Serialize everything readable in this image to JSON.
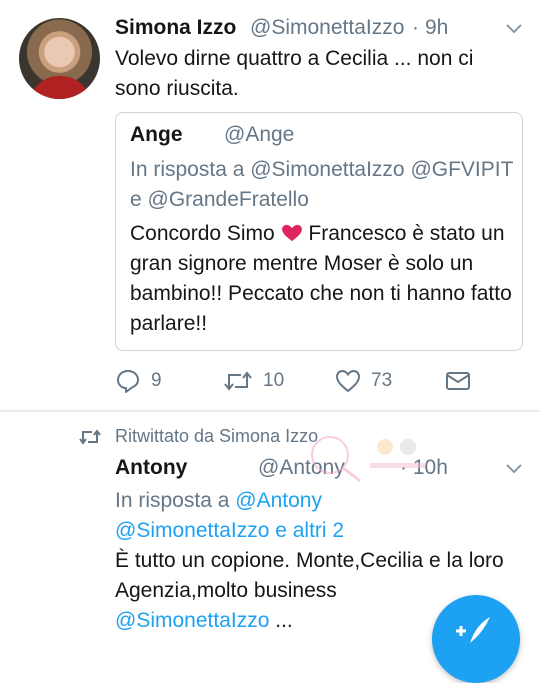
{
  "tweet": {
    "author_name": "Simona Izzo",
    "author_handle": "@SimonettaIzzo",
    "separator": "·",
    "time": "9h",
    "text": "Volevo dirne quattro a Cecilia ... non ci sono riuscita.",
    "quoted": {
      "author_name": "Ange",
      "author_handle": "@Ange",
      "reply_to": "In risposta a @SimonettaIzzo @GFVIPIT e @GrandeFratello",
      "text_before": "Concordo Simo",
      "text_after": "Francesco è stato un gran signore mentre Moser è solo un bambino!! Peccato che non ti hanno fatto parlare!!"
    },
    "actions": {
      "replies": "9",
      "retweets": "10",
      "likes": "73"
    }
  },
  "retweet": {
    "label": "Ritwittato da Simona Izzo",
    "author_name": "Antony",
    "author_handle": "@Antony",
    "separator": "·",
    "time": "10h",
    "reply_prefix": "In risposta a",
    "reply_handle": "@Antony",
    "reply_rest": "@SimonettaIzzo e altri 2",
    "text": "È tutto un copione. Monte,Cecilia e la loro Agenzia,molto business",
    "mention": "@SimonettaIzzo",
    "ellipsis": "..."
  },
  "colors": {
    "accent": "#1da1f2",
    "secondary_text": "#657786",
    "heart": "#e0245e"
  }
}
